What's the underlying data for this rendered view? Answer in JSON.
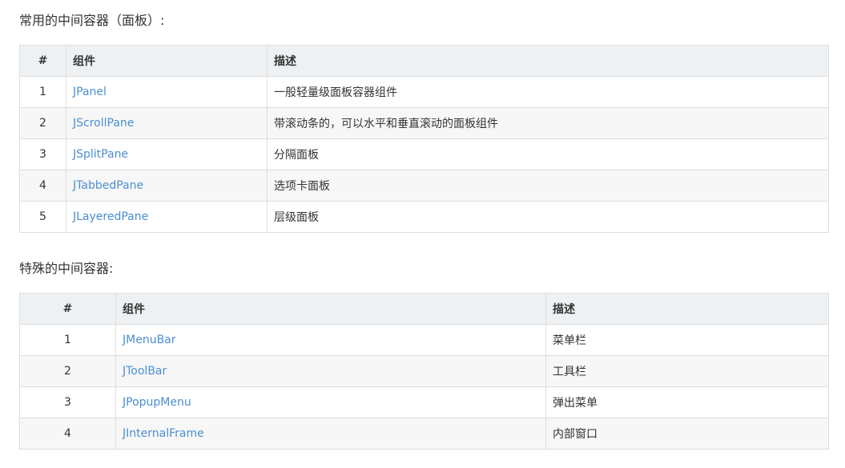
{
  "sections": [
    {
      "heading": "常用的中间容器（面板）:",
      "headers": [
        "#",
        "组件",
        "描述"
      ],
      "rows": [
        {
          "num": "1",
          "component": "JPanel",
          "description": "一般轻量级面板容器组件"
        },
        {
          "num": "2",
          "component": "JScrollPane",
          "description": "带滚动条的，可以水平和垂直滚动的面板组件"
        },
        {
          "num": "3",
          "component": "JSplitPane",
          "description": "分隔面板"
        },
        {
          "num": "4",
          "component": "JTabbedPane",
          "description": "选项卡面板"
        },
        {
          "num": "5",
          "component": "JLayeredPane",
          "description": "层级面板"
        }
      ]
    },
    {
      "heading": "特殊的中间容器:",
      "headers": [
        "#",
        "组件",
        "描述"
      ],
      "rows": [
        {
          "num": "1",
          "component": "JMenuBar",
          "description": "菜单栏"
        },
        {
          "num": "2",
          "component": "JToolBar",
          "description": "工具栏"
        },
        {
          "num": "3",
          "component": "JPopupMenu",
          "description": "弹出菜单"
        },
        {
          "num": "4",
          "component": "JInternalFrame",
          "description": "内部窗口"
        }
      ]
    }
  ],
  "colors": {
    "link": "#4a8fd0",
    "header_bg": "#eef1f4",
    "stripe_bg": "#f7f7f7",
    "border": "#dddddd"
  }
}
